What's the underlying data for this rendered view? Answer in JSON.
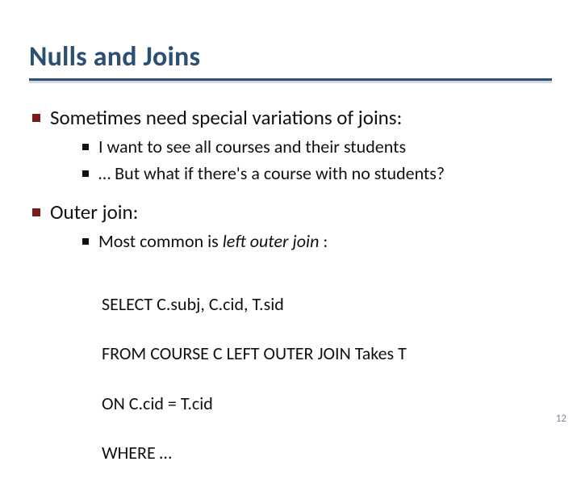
{
  "title": "Nulls and Joins",
  "bullets": {
    "b1": "Sometimes need special variations of joins:",
    "b1a": "I want to see all courses and their students",
    "b1b": "… But what if there's a course with no students?",
    "b2": "Outer join:",
    "b2a_pre": "Most common is ",
    "b2a_em": "left outer join",
    "b2a_post": " :"
  },
  "code": {
    "l1": "SELECT C.subj, C.cid, T.sid",
    "l2": "FROM COURSE C LEFT OUTER JOIN Takes T",
    "l3": "ON C.cid = T.cid",
    "l4": "WHERE …"
  },
  "page_number": "12"
}
